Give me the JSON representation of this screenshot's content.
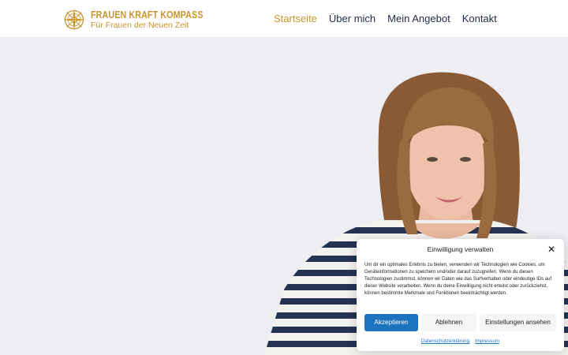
{
  "brand": {
    "name": "FRAUEN KRAFT KOMPASS",
    "tagline": "Für Frauen der Neuen Zeit",
    "icon": "compass-logo-icon",
    "color": "#c9952e"
  },
  "nav": {
    "items": [
      {
        "label": "Startseite",
        "active": true
      },
      {
        "label": "Über mich",
        "active": false
      },
      {
        "label": "Mein Angebot",
        "active": false
      },
      {
        "label": "Kontakt",
        "active": false
      }
    ],
    "active_color": "#c9952e",
    "text_color": "#1f2a44"
  },
  "hero": {
    "background": "#eceef2",
    "image": "portrait-photo"
  },
  "consent": {
    "title": "Einwilligung verwalten",
    "close_icon": "close-icon",
    "body": "Um dir ein optimales Erlebnis zu bieten, verwenden wir Technologien wie Cookies, um Geräteinformationen zu speichern und/oder darauf zuzugreifen. Wenn du diesen Technologien zustimmst, können wir Daten wie das Surfverhalten oder eindeutige IDs auf dieser Website verarbeiten. Wenn du deine Einwilligung nicht erteilst oder zurückziehst, können bestimmte Merkmale und Funktionen beeinträchtigt werden.",
    "accept_label": "Akzeptieren",
    "deny_label": "Ablehnen",
    "settings_label": "Einstellungen ansehen",
    "privacy_link": "Datenschutzerklärung",
    "imprint_link": "Impressum",
    "accent": "#1e73be"
  }
}
